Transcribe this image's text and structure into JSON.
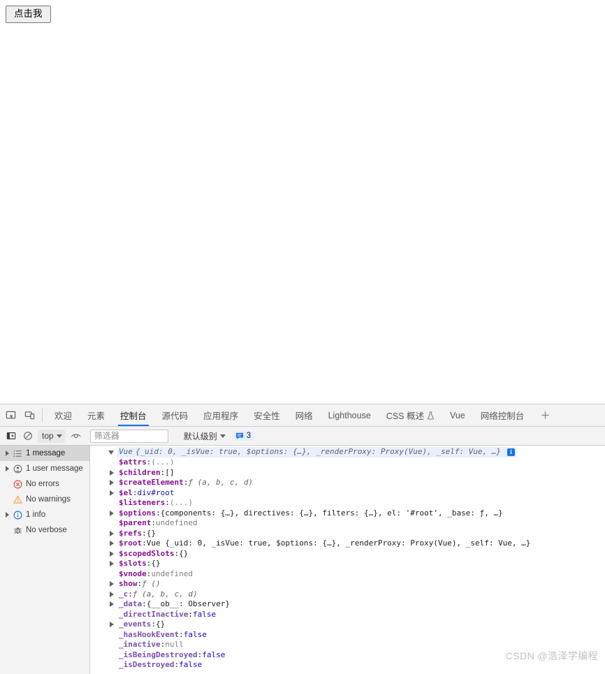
{
  "page": {
    "button_label": "点击我"
  },
  "devtools": {
    "left_icons": [
      {
        "name": "inspect-element-icon",
        "title": "检查元素"
      },
      {
        "name": "device-toolbar-icon",
        "title": "切换设备工具栏"
      }
    ],
    "tabs": [
      {
        "label": "欢迎",
        "active": false
      },
      {
        "label": "元素",
        "active": false
      },
      {
        "label": "控制台",
        "active": true
      },
      {
        "label": "源代码",
        "active": false
      },
      {
        "label": "应用程序",
        "active": false
      },
      {
        "label": "安全性",
        "active": false
      },
      {
        "label": "网络",
        "active": false
      },
      {
        "label": "Lighthouse",
        "active": false
      },
      {
        "label": "CSS 概述",
        "active": false,
        "icon": "flask-icon"
      },
      {
        "label": "Vue",
        "active": false
      },
      {
        "label": "网络控制台",
        "active": false
      }
    ],
    "add_tab_label": "+",
    "toolbar": {
      "sidebar_toggle": "console-sidebar-toggle",
      "clear_console": "clear-console-icon",
      "context_value": "top",
      "live_expression": "eye-icon",
      "filter_placeholder": "筛选器",
      "filter_value": "",
      "level_label": "默认级别",
      "message_count": "3"
    },
    "sidebar": [
      {
        "label": "1 message",
        "icon": "list-icon",
        "expandable": true,
        "selected": true
      },
      {
        "label": "1 user message",
        "icon": "user-icon",
        "expandable": true,
        "selected": false
      },
      {
        "label": "No errors",
        "icon": "error-icon",
        "expandable": false,
        "selected": false
      },
      {
        "label": "No warnings",
        "icon": "warning-icon",
        "expandable": false,
        "selected": false
      },
      {
        "label": "1 info",
        "icon": "info-icon",
        "expandable": true,
        "selected": false
      },
      {
        "label": "No verbose",
        "icon": "bug-icon",
        "expandable": false,
        "selected": false
      }
    ],
    "console": {
      "header": {
        "class_name": "Vue",
        "summary": "{_uid: 0, _isVue: true, $options: {…}, _renderProxy: Proxy(Vue), _self: Vue, …}",
        "badge": "i"
      },
      "properties": [
        {
          "disclosure": "none",
          "name": "$attrs",
          "value": "(...)",
          "kind": "muted"
        },
        {
          "disclosure": "closed",
          "name": "$children",
          "value": "[]",
          "kind": "obj"
        },
        {
          "disclosure": "closed",
          "name": "$createElement",
          "value": "ƒ (a, b, c, d)",
          "kind": "fn"
        },
        {
          "disclosure": "closed",
          "name": "$el",
          "value": "div#root",
          "kind": "node"
        },
        {
          "disclosure": "none",
          "name": "$listeners",
          "value": "(...)",
          "kind": "muted"
        },
        {
          "disclosure": "closed",
          "name": "$options",
          "value": "{components: {…}, directives: {…}, filters: {…}, el: '#root', _base: ƒ, …}",
          "kind": "obj"
        },
        {
          "disclosure": "none",
          "name": "$parent",
          "value": "undefined",
          "kind": "undef"
        },
        {
          "disclosure": "closed",
          "name": "$refs",
          "value": "{}",
          "kind": "obj"
        },
        {
          "disclosure": "closed",
          "name": "$root",
          "value": "Vue {_uid: 0, _isVue: true, $options: {…}, _renderProxy: Proxy(Vue), _self: Vue, …}",
          "kind": "obj"
        },
        {
          "disclosure": "closed",
          "name": "$scopedSlots",
          "value": "{}",
          "kind": "obj"
        },
        {
          "disclosure": "closed",
          "name": "$slots",
          "value": "{}",
          "kind": "obj"
        },
        {
          "disclosure": "none",
          "name": "$vnode",
          "value": "undefined",
          "kind": "undef"
        },
        {
          "disclosure": "closed",
          "name": "show",
          "value": "ƒ ()",
          "kind": "fn"
        },
        {
          "disclosure": "closed",
          "name": "_c",
          "value": "ƒ (a, b, c, d)",
          "kind": "fn"
        },
        {
          "disclosure": "closed",
          "name": "_data",
          "value": "{__ob__: Observer}",
          "kind": "obj"
        },
        {
          "disclosure": "none",
          "name": "_directInactive",
          "value": "false",
          "kind": "bool"
        },
        {
          "disclosure": "closed",
          "name": "_events",
          "value": "{}",
          "kind": "obj"
        },
        {
          "disclosure": "none",
          "name": "_hasHookEvent",
          "value": "false",
          "kind": "bool"
        },
        {
          "disclosure": "none",
          "name": "_inactive",
          "value": "null",
          "kind": "null"
        },
        {
          "disclosure": "none",
          "name": "_isBeingDestroyed",
          "value": "false",
          "kind": "bool"
        },
        {
          "disclosure": "none",
          "name": "_isDestroyed",
          "value": "false",
          "kind": "bool"
        }
      ]
    }
  },
  "watermark": "CSDN @浩泽学编程"
}
